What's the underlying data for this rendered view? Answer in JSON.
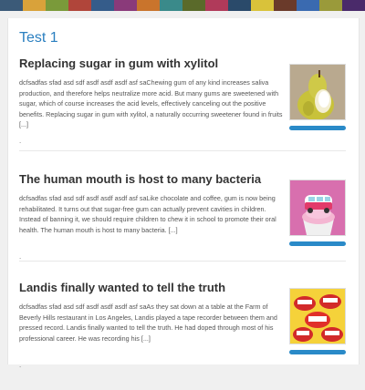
{
  "colors": {
    "accent": "#2a7fc0",
    "bar": "#2a8ac8",
    "strip": [
      "#3b5a78",
      "#d9a23a",
      "#7a9a3a",
      "#b0453a",
      "#355c8a",
      "#8a3a7a",
      "#c9742c",
      "#3a8a8a",
      "#5a6a2a",
      "#b03a5a",
      "#2a4a6a",
      "#d9c23a",
      "#6a3a2a",
      "#3a6ab0",
      "#9a9a3a",
      "#4a2a6a"
    ]
  },
  "page": {
    "title": "Test 1"
  },
  "posts": [
    {
      "title": "Replacing sugar in gum with xylitol",
      "excerpt": "dcfsadfas sfad asd sdf asdf asdf asdf asf saChewing gum of any kind increases saliva production, and therefore helps neutralize more acid. But many gums are sweetened with sugar, which of course increases the acid levels, effectively canceling out the positive benefits. Replacing sugar in gum with xylitol, a naturally occurring sweetener found in fruits [...]",
      "dot": ".",
      "image_icon": "pear-icon"
    },
    {
      "title": "The human mouth is host to many bacteria",
      "excerpt": "dcfsadfas sfad asd sdf asdf asdf asdf asf saLike chocolate and coffee, gum is now being rehabilitated. It turns out that sugar-free gum can actually prevent cavities in children. Instead of banning it, we should require children to chew it in school to promote their oral health. The human mouth is host to many bacteria. [...]",
      "dot": ".",
      "image_icon": "cupcake-van-icon"
    },
    {
      "title": "Landis finally wanted to tell the truth",
      "excerpt": "dcfsadfas sfad asd sdf asdf asdf asdf asf saAs they sat down at a table at the Farm of Beverly Hills restaurant in Los Angeles, Landis played a tape recorder between them and pressed record. Landis finally wanted to tell the truth. He had doped through most of his professional career. He was recording his [...]",
      "dot": ".",
      "image_icon": "chattering-teeth-icon"
    }
  ]
}
